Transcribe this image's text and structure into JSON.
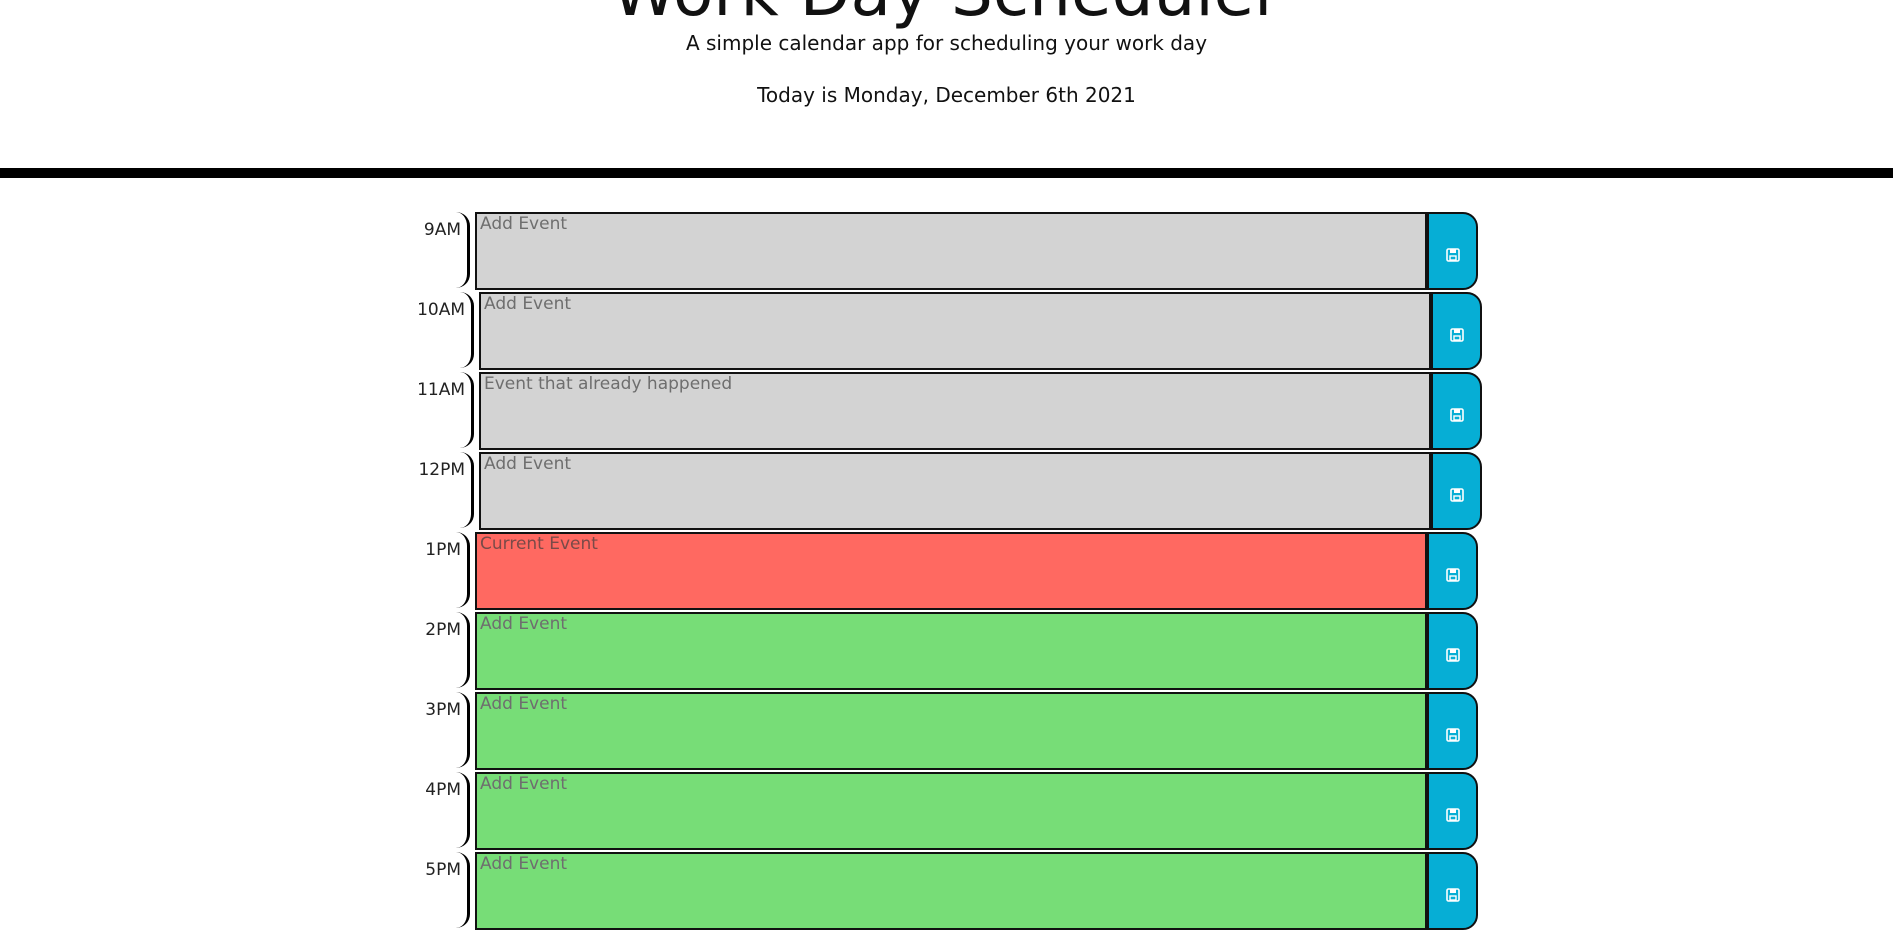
{
  "header": {
    "title": "Work Day Scheduler",
    "subtitle": "A simple calendar app for scheduling your work day",
    "current_day": "Today is Monday, December 6th 2021"
  },
  "colors": {
    "past": "#d3d3d3",
    "present": "#ff6961",
    "future": "#77dd77",
    "save_button": "#06aed5",
    "divider": "#000000"
  },
  "time_blocks": [
    {
      "hour": "9AM",
      "value": "",
      "placeholder": "Add Event",
      "status": "past",
      "save_icon": "save-icon"
    },
    {
      "hour": "10AM",
      "value": "",
      "placeholder": "Add Event",
      "status": "past",
      "save_icon": "save-icon"
    },
    {
      "hour": "11AM",
      "value": "",
      "placeholder": "Event that already happened",
      "status": "past",
      "save_icon": "save-icon"
    },
    {
      "hour": "12PM",
      "value": "",
      "placeholder": "Add Event",
      "status": "past",
      "save_icon": "save-icon"
    },
    {
      "hour": "1PM",
      "value": "",
      "placeholder": "Current Event",
      "status": "present",
      "save_icon": "save-icon"
    },
    {
      "hour": "2PM",
      "value": "",
      "placeholder": "Add Event",
      "status": "future",
      "save_icon": "save-icon"
    },
    {
      "hour": "3PM",
      "value": "",
      "placeholder": "Add Event",
      "status": "future",
      "save_icon": "save-icon"
    },
    {
      "hour": "4PM",
      "value": "",
      "placeholder": "Add Event",
      "status": "future",
      "save_icon": "save-icon"
    },
    {
      "hour": "5PM",
      "value": "",
      "placeholder": "Add Event",
      "status": "future",
      "save_icon": "save-icon"
    }
  ]
}
